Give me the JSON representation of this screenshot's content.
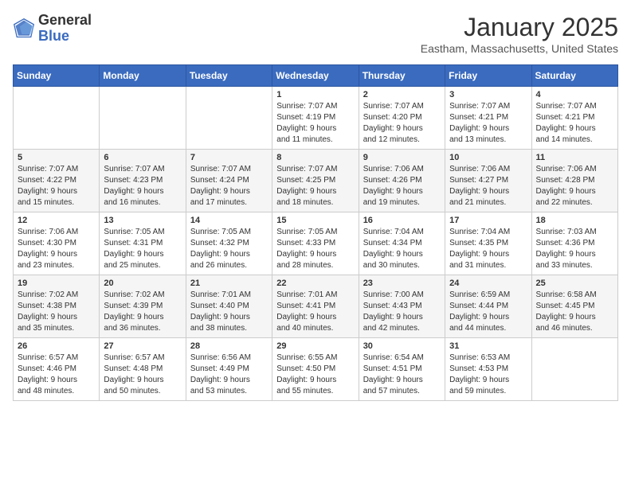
{
  "header": {
    "logo_general": "General",
    "logo_blue": "Blue",
    "month_title": "January 2025",
    "location": "Eastham, Massachusetts, United States"
  },
  "weekdays": [
    "Sunday",
    "Monday",
    "Tuesday",
    "Wednesday",
    "Thursday",
    "Friday",
    "Saturday"
  ],
  "weeks": [
    [
      {
        "day": "",
        "info": ""
      },
      {
        "day": "",
        "info": ""
      },
      {
        "day": "",
        "info": ""
      },
      {
        "day": "1",
        "info": "Sunrise: 7:07 AM\nSunset: 4:19 PM\nDaylight: 9 hours\nand 11 minutes."
      },
      {
        "day": "2",
        "info": "Sunrise: 7:07 AM\nSunset: 4:20 PM\nDaylight: 9 hours\nand 12 minutes."
      },
      {
        "day": "3",
        "info": "Sunrise: 7:07 AM\nSunset: 4:21 PM\nDaylight: 9 hours\nand 13 minutes."
      },
      {
        "day": "4",
        "info": "Sunrise: 7:07 AM\nSunset: 4:21 PM\nDaylight: 9 hours\nand 14 minutes."
      }
    ],
    [
      {
        "day": "5",
        "info": "Sunrise: 7:07 AM\nSunset: 4:22 PM\nDaylight: 9 hours\nand 15 minutes."
      },
      {
        "day": "6",
        "info": "Sunrise: 7:07 AM\nSunset: 4:23 PM\nDaylight: 9 hours\nand 16 minutes."
      },
      {
        "day": "7",
        "info": "Sunrise: 7:07 AM\nSunset: 4:24 PM\nDaylight: 9 hours\nand 17 minutes."
      },
      {
        "day": "8",
        "info": "Sunrise: 7:07 AM\nSunset: 4:25 PM\nDaylight: 9 hours\nand 18 minutes."
      },
      {
        "day": "9",
        "info": "Sunrise: 7:06 AM\nSunset: 4:26 PM\nDaylight: 9 hours\nand 19 minutes."
      },
      {
        "day": "10",
        "info": "Sunrise: 7:06 AM\nSunset: 4:27 PM\nDaylight: 9 hours\nand 21 minutes."
      },
      {
        "day": "11",
        "info": "Sunrise: 7:06 AM\nSunset: 4:28 PM\nDaylight: 9 hours\nand 22 minutes."
      }
    ],
    [
      {
        "day": "12",
        "info": "Sunrise: 7:06 AM\nSunset: 4:30 PM\nDaylight: 9 hours\nand 23 minutes."
      },
      {
        "day": "13",
        "info": "Sunrise: 7:05 AM\nSunset: 4:31 PM\nDaylight: 9 hours\nand 25 minutes."
      },
      {
        "day": "14",
        "info": "Sunrise: 7:05 AM\nSunset: 4:32 PM\nDaylight: 9 hours\nand 26 minutes."
      },
      {
        "day": "15",
        "info": "Sunrise: 7:05 AM\nSunset: 4:33 PM\nDaylight: 9 hours\nand 28 minutes."
      },
      {
        "day": "16",
        "info": "Sunrise: 7:04 AM\nSunset: 4:34 PM\nDaylight: 9 hours\nand 30 minutes."
      },
      {
        "day": "17",
        "info": "Sunrise: 7:04 AM\nSunset: 4:35 PM\nDaylight: 9 hours\nand 31 minutes."
      },
      {
        "day": "18",
        "info": "Sunrise: 7:03 AM\nSunset: 4:36 PM\nDaylight: 9 hours\nand 33 minutes."
      }
    ],
    [
      {
        "day": "19",
        "info": "Sunrise: 7:02 AM\nSunset: 4:38 PM\nDaylight: 9 hours\nand 35 minutes."
      },
      {
        "day": "20",
        "info": "Sunrise: 7:02 AM\nSunset: 4:39 PM\nDaylight: 9 hours\nand 36 minutes."
      },
      {
        "day": "21",
        "info": "Sunrise: 7:01 AM\nSunset: 4:40 PM\nDaylight: 9 hours\nand 38 minutes."
      },
      {
        "day": "22",
        "info": "Sunrise: 7:01 AM\nSunset: 4:41 PM\nDaylight: 9 hours\nand 40 minutes."
      },
      {
        "day": "23",
        "info": "Sunrise: 7:00 AM\nSunset: 4:43 PM\nDaylight: 9 hours\nand 42 minutes."
      },
      {
        "day": "24",
        "info": "Sunrise: 6:59 AM\nSunset: 4:44 PM\nDaylight: 9 hours\nand 44 minutes."
      },
      {
        "day": "25",
        "info": "Sunrise: 6:58 AM\nSunset: 4:45 PM\nDaylight: 9 hours\nand 46 minutes."
      }
    ],
    [
      {
        "day": "26",
        "info": "Sunrise: 6:57 AM\nSunset: 4:46 PM\nDaylight: 9 hours\nand 48 minutes."
      },
      {
        "day": "27",
        "info": "Sunrise: 6:57 AM\nSunset: 4:48 PM\nDaylight: 9 hours\nand 50 minutes."
      },
      {
        "day": "28",
        "info": "Sunrise: 6:56 AM\nSunset: 4:49 PM\nDaylight: 9 hours\nand 53 minutes."
      },
      {
        "day": "29",
        "info": "Sunrise: 6:55 AM\nSunset: 4:50 PM\nDaylight: 9 hours\nand 55 minutes."
      },
      {
        "day": "30",
        "info": "Sunrise: 6:54 AM\nSunset: 4:51 PM\nDaylight: 9 hours\nand 57 minutes."
      },
      {
        "day": "31",
        "info": "Sunrise: 6:53 AM\nSunset: 4:53 PM\nDaylight: 9 hours\nand 59 minutes."
      },
      {
        "day": "",
        "info": ""
      }
    ]
  ]
}
